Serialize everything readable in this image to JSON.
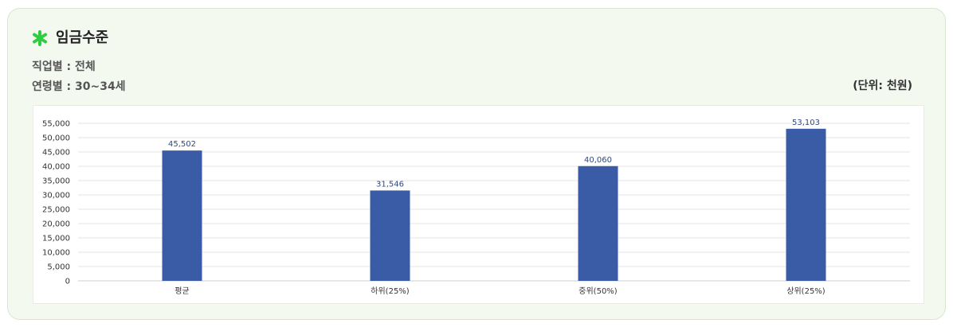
{
  "header": {
    "title": "임금수준",
    "icon": "asterisk-icon",
    "icon_color": "#2ecc40"
  },
  "filters": {
    "job": "직업별 : 전체",
    "age": "연령별 : 30~34세"
  },
  "unit_label": "(단위: 천원)",
  "chart_data": {
    "type": "bar",
    "categories": [
      "평균",
      "하위(25%)",
      "중위(50%)",
      "상위(25%)"
    ],
    "values": [
      45502,
      31546,
      40060,
      53103
    ],
    "value_labels": [
      "45,502",
      "31,546",
      "40,060",
      "53,103"
    ],
    "ylim": [
      0,
      55000
    ],
    "yticks": [
      "0",
      "5,000",
      "10,000",
      "15,000",
      "20,000",
      "25,000",
      "30,000",
      "35,000",
      "40,000",
      "45,000",
      "50,000",
      "55,000"
    ],
    "grid": true,
    "bar_color": "#3a5ba5",
    "label_color": "#2f4a85"
  }
}
